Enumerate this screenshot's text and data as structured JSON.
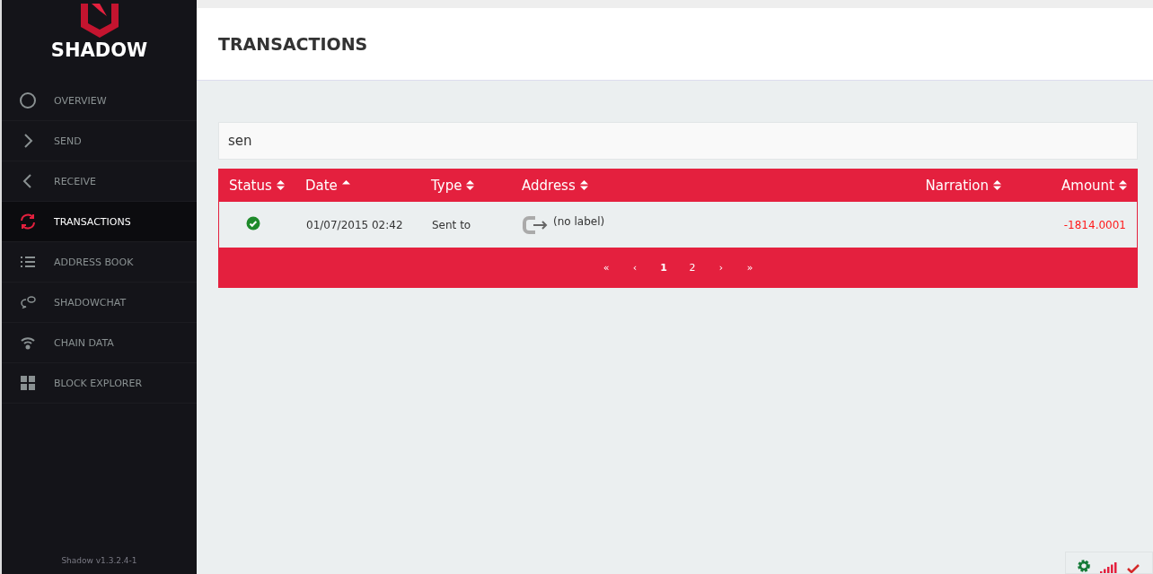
{
  "sidebar": {
    "brand": "SHADOW",
    "items": [
      {
        "label": "OVERVIEW",
        "selected": false
      },
      {
        "label": "SEND",
        "selected": false
      },
      {
        "label": "RECEIVE",
        "selected": false
      },
      {
        "label": "TRANSACTIONS",
        "selected": true
      },
      {
        "label": "ADDRESS BOOK",
        "selected": false
      },
      {
        "label": "SHADOWCHAT",
        "selected": false
      },
      {
        "label": "CHAIN DATA",
        "selected": false
      },
      {
        "label": "BLOCK EXPLORER",
        "selected": false
      }
    ],
    "version": "Shadow v1.3.2.4-1"
  },
  "page_title": "TRANSACTIONS",
  "search": {
    "value": "sen"
  },
  "table": {
    "columns": [
      {
        "label": "Status",
        "sorted": false
      },
      {
        "label": "Date",
        "sorted": true
      },
      {
        "label": "Type",
        "sorted": false
      },
      {
        "label": "Address",
        "sorted": false
      },
      {
        "label": "Narration",
        "sorted": false
      },
      {
        "label": "Amount",
        "sorted": false
      }
    ],
    "rows": [
      {
        "confirmed": true,
        "date": "01/07/2015 02:42",
        "type": "Sent to",
        "address": "(no label)",
        "amount": "-1814.0001"
      }
    ]
  },
  "pagination": [
    {
      "label": "«",
      "selected": false
    },
    {
      "label": "‹",
      "selected": false
    },
    {
      "label": "1",
      "selected": true
    },
    {
      "label": "2",
      "selected": false
    },
    {
      "label": "›",
      "selected": false
    },
    {
      "label": "»",
      "selected": false
    }
  ]
}
